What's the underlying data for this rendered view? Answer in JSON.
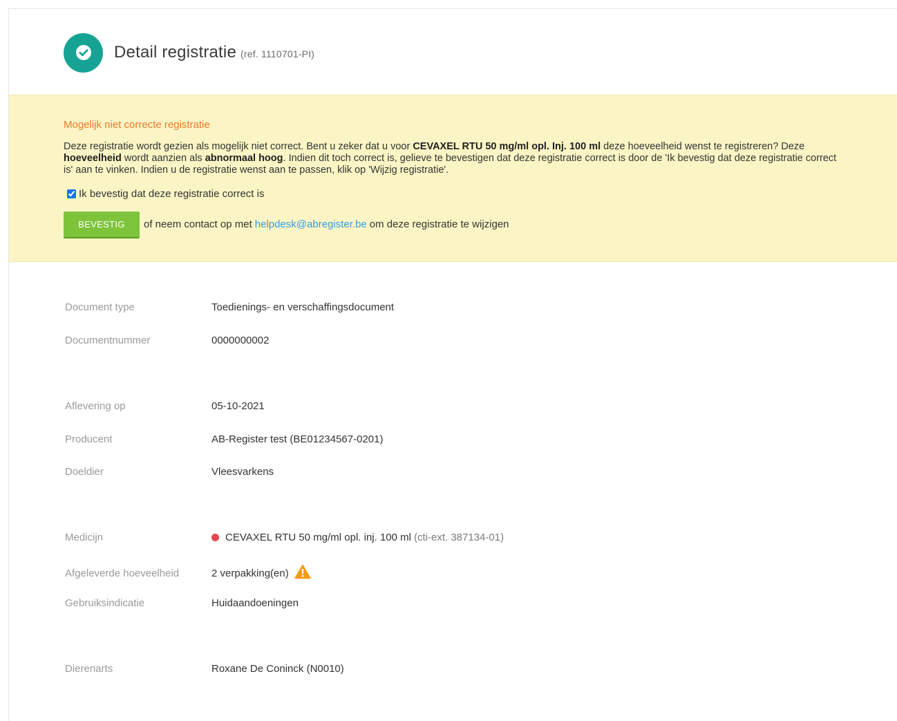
{
  "header": {
    "title": "Detail registratie",
    "ref": "(ref. 1110701-PI)"
  },
  "alert": {
    "title": "Mogelijk niet correcte registratie",
    "body": {
      "t1": "Deze registratie wordt gezien als mogelijk niet correct. Bent u zeker dat u voor ",
      "b1": "CEVAXEL RTU 50 mg/ml opl. Inj. 100 ml",
      "t2": " deze hoeveelheid wenst te registreren? Deze ",
      "b2": "hoeveelheid",
      "t3": " wordt aanzien als ",
      "b3": "abnormaal hoog",
      "t4": ". Indien dit toch correct is, gelieve te bevestigen dat deze registratie correct is door de 'Ik bevestig dat deze registratie correct is' aan te vinken. Indien u de registratie wenst aan te passen, klik op 'Wijzig registratie'."
    },
    "checkbox_label": "Ik bevestig dat deze registratie correct is",
    "checkbox_checked": true,
    "button_label": "BEVESTIG",
    "contact_prefix": "of neem contact op met",
    "contact_email": "helpdesk@abregister.be",
    "contact_suffix": "om deze registratie te wijzigen"
  },
  "details": {
    "document_type": {
      "label": "Document type",
      "value": "Toedienings- en verschaffingsdocument"
    },
    "document_number": {
      "label": "Documentnummer",
      "value": "0000000002"
    },
    "delivery_date": {
      "label": "Aflevering op",
      "value": "05-10-2021"
    },
    "producer": {
      "label": "Producent",
      "value": "AB-Register test (BE01234567-0201)"
    },
    "target_animal": {
      "label": "Doeldier",
      "value": "Vleesvarkens"
    },
    "medicine": {
      "label": "Medicijn",
      "value": "CEVAXEL RTU 50 mg/ml opl. inj. 100 ml",
      "code": "(cti-ext. 387134-01)"
    },
    "quantity": {
      "label": "Afgeleverde hoeveelheid",
      "value": "2 verpakking(en)"
    },
    "indication": {
      "label": "Gebruiksindicatie",
      "value": "Huidaandoeningen"
    },
    "veterinarian": {
      "label": "Dierenarts",
      "value": "Roxane De Coninck (N0010)"
    }
  },
  "icons": {
    "status": "check-circle-icon",
    "medicine_status": "red-dot-icon",
    "quantity_warning": "warning-triangle-icon"
  },
  "colors": {
    "accent_teal": "#16a394",
    "alert_background": "#fbf5c5",
    "alert_title": "#f0772b",
    "button_green": "#7dc43b",
    "link_blue": "#2f9de6",
    "danger_red": "#e8474f",
    "warning_orange": "#f39c12"
  }
}
